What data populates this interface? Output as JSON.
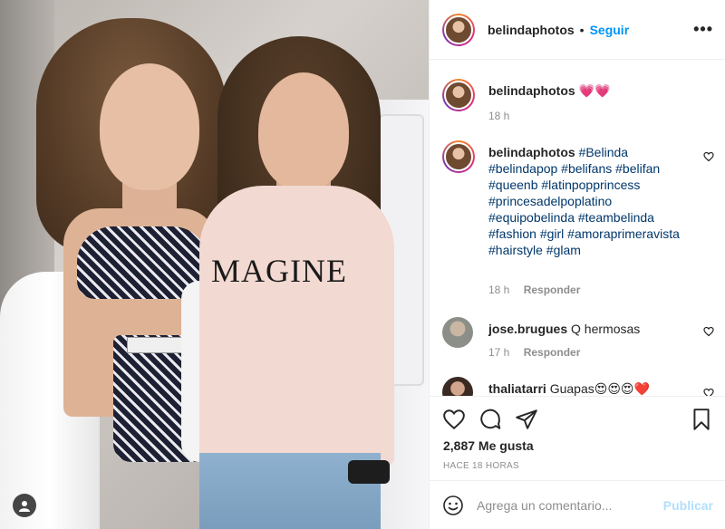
{
  "post": {
    "username": "belindaphotos",
    "follow_label": "Seguir",
    "more_label": "•••",
    "shirt_text": "MAGINE"
  },
  "comments": [
    {
      "username": "belindaphotos",
      "text": "💗💗",
      "time": "18 h",
      "reply": ""
    },
    {
      "username": "belindaphotos",
      "text": "#Belinda #belindapop #belifans #belifan #queenb #latinpopprincess #princesadelpoplatino #equipobelinda #teambelinda #fashion #girl #amoraprimeravista #hairstyle #glam",
      "time": "18 h",
      "reply": "Responder"
    },
    {
      "username": "jose.brugues",
      "text": "Q hermosas",
      "time": "17 h",
      "reply": "Responder"
    },
    {
      "username": "thaliatarri",
      "text": "Guapas😍😍😍❤️",
      "time": "",
      "reply": ""
    }
  ],
  "footer": {
    "likes": "2,887 Me gusta",
    "timestamp": "HACE 18 HORAS",
    "comment_placeholder": "Agrega un comentario...",
    "publish_label": "Publicar"
  }
}
